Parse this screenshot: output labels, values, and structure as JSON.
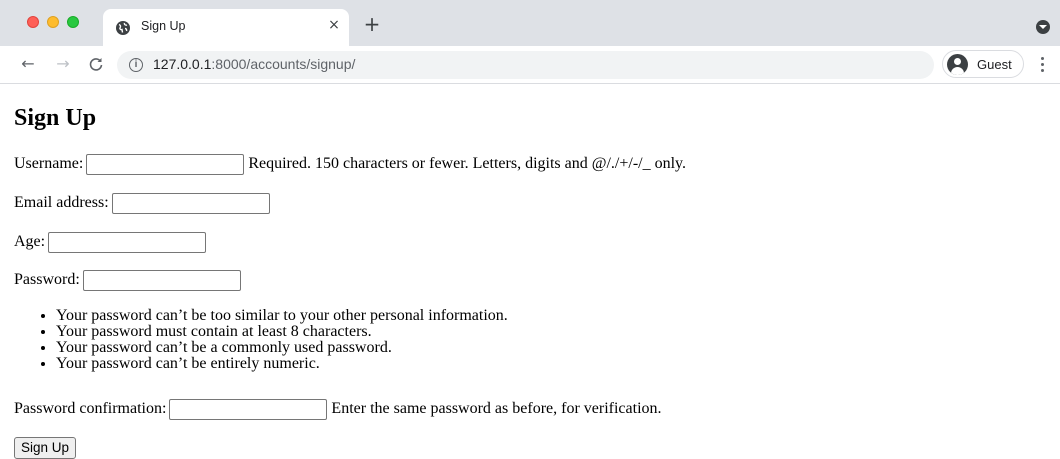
{
  "browser": {
    "tab_title": "Sign Up",
    "tab_close": "×",
    "new_tab": "+",
    "url_host": "127.0.0.1",
    "url_rest": ":8000/accounts/signup/",
    "info_icon": "i",
    "profile_label": "Guest",
    "icons": {
      "back": "back-arrow-icon",
      "forward": "forward-arrow-icon",
      "reload": "reload-icon",
      "favicon": "globe-icon",
      "menu": "three-dot-menu-icon"
    },
    "nav": {
      "back": "←",
      "forward": "→",
      "reload": "C"
    }
  },
  "page": {
    "title": "Sign Up",
    "fields": {
      "username": {
        "label": "Username:",
        "value": "",
        "help": "Required. 150 characters or fewer. Letters, digits and @/./+/-/_ only."
      },
      "email": {
        "label": "Email address:",
        "value": ""
      },
      "age": {
        "label": "Age:",
        "value": ""
      },
      "password": {
        "label": "Password:",
        "value": ""
      },
      "password_confirmation": {
        "label": "Password confirmation:",
        "value": "",
        "help": "Enter the same password as before, for verification."
      }
    },
    "password_rules": [
      "Your password can’t be too similar to your other personal information.",
      "Your password must contain at least 8 characters.",
      "Your password can’t be a commonly used password.",
      "Your password can’t be entirely numeric."
    ],
    "submit_label": "Sign Up"
  }
}
